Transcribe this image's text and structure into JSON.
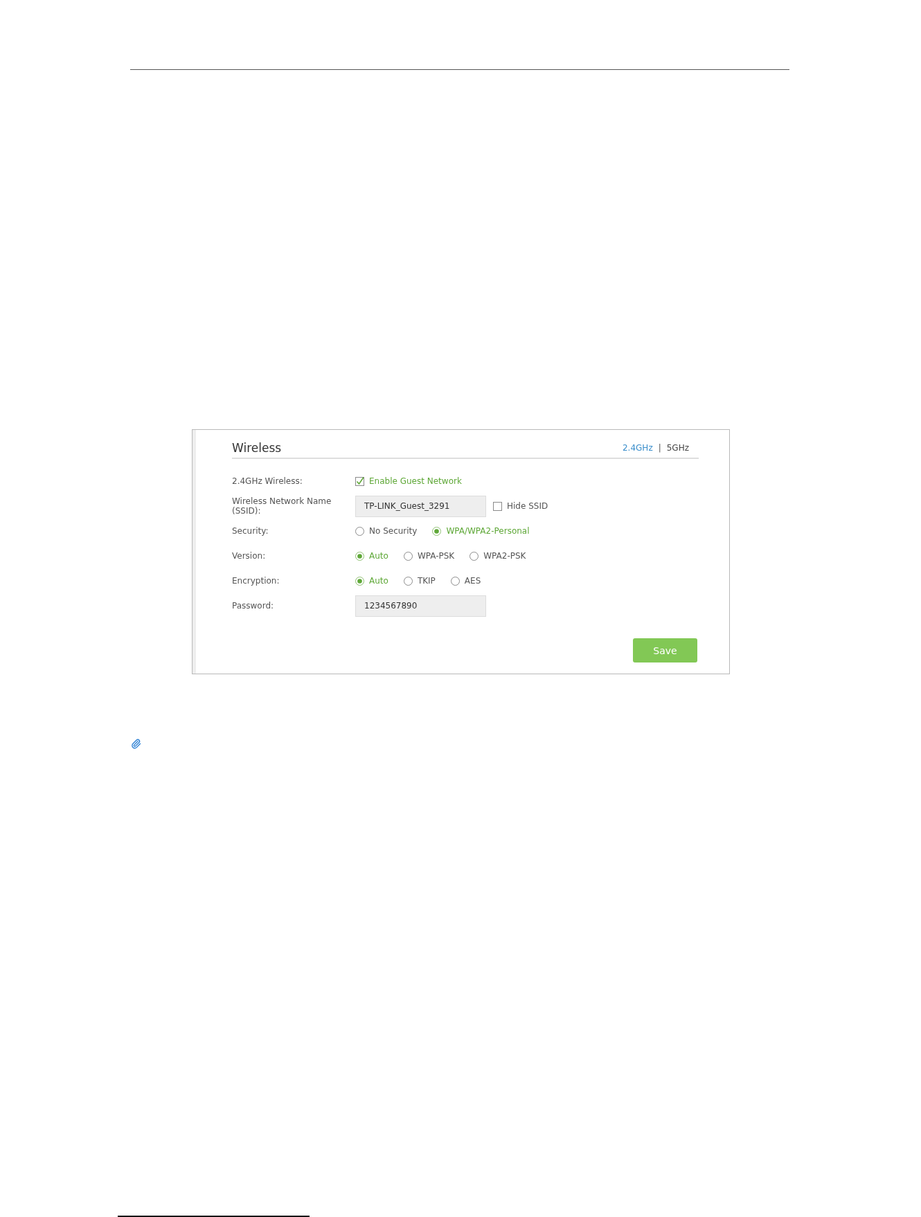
{
  "panel": {
    "title": "Wireless",
    "bands": [
      {
        "label": "2.4GHz",
        "selected": true
      },
      {
        "label": "5GHz",
        "selected": false
      }
    ],
    "band_separator": "|",
    "fields": [
      {
        "kind": "checkbox",
        "label": "2.4GHz Wireless:",
        "options": [
          {
            "label": "Enable Guest Network",
            "checked": true
          }
        ]
      },
      {
        "kind": "text",
        "label": "Wireless Network Name (SSID):",
        "value": "TP-LINK_Guest_3291",
        "options": [
          {
            "label": "Hide SSID",
            "checked": false
          }
        ]
      },
      {
        "kind": "radio",
        "label": "Security:",
        "options": [
          {
            "label": "No Security",
            "selected": false
          },
          {
            "label": "WPA/WPA2-Personal",
            "selected": true
          }
        ]
      },
      {
        "kind": "radio",
        "label": "Version:",
        "options": [
          {
            "label": "Auto",
            "selected": true
          },
          {
            "label": "WPA-PSK",
            "selected": false
          },
          {
            "label": "WPA2-PSK",
            "selected": false
          }
        ]
      },
      {
        "kind": "radio",
        "label": "Encryption:",
        "options": [
          {
            "label": "Auto",
            "selected": true
          },
          {
            "label": "TKIP",
            "selected": false
          },
          {
            "label": "AES",
            "selected": false
          }
        ]
      },
      {
        "kind": "text",
        "label": "Password:",
        "value": "1234567890"
      }
    ],
    "save_button": "Save"
  }
}
